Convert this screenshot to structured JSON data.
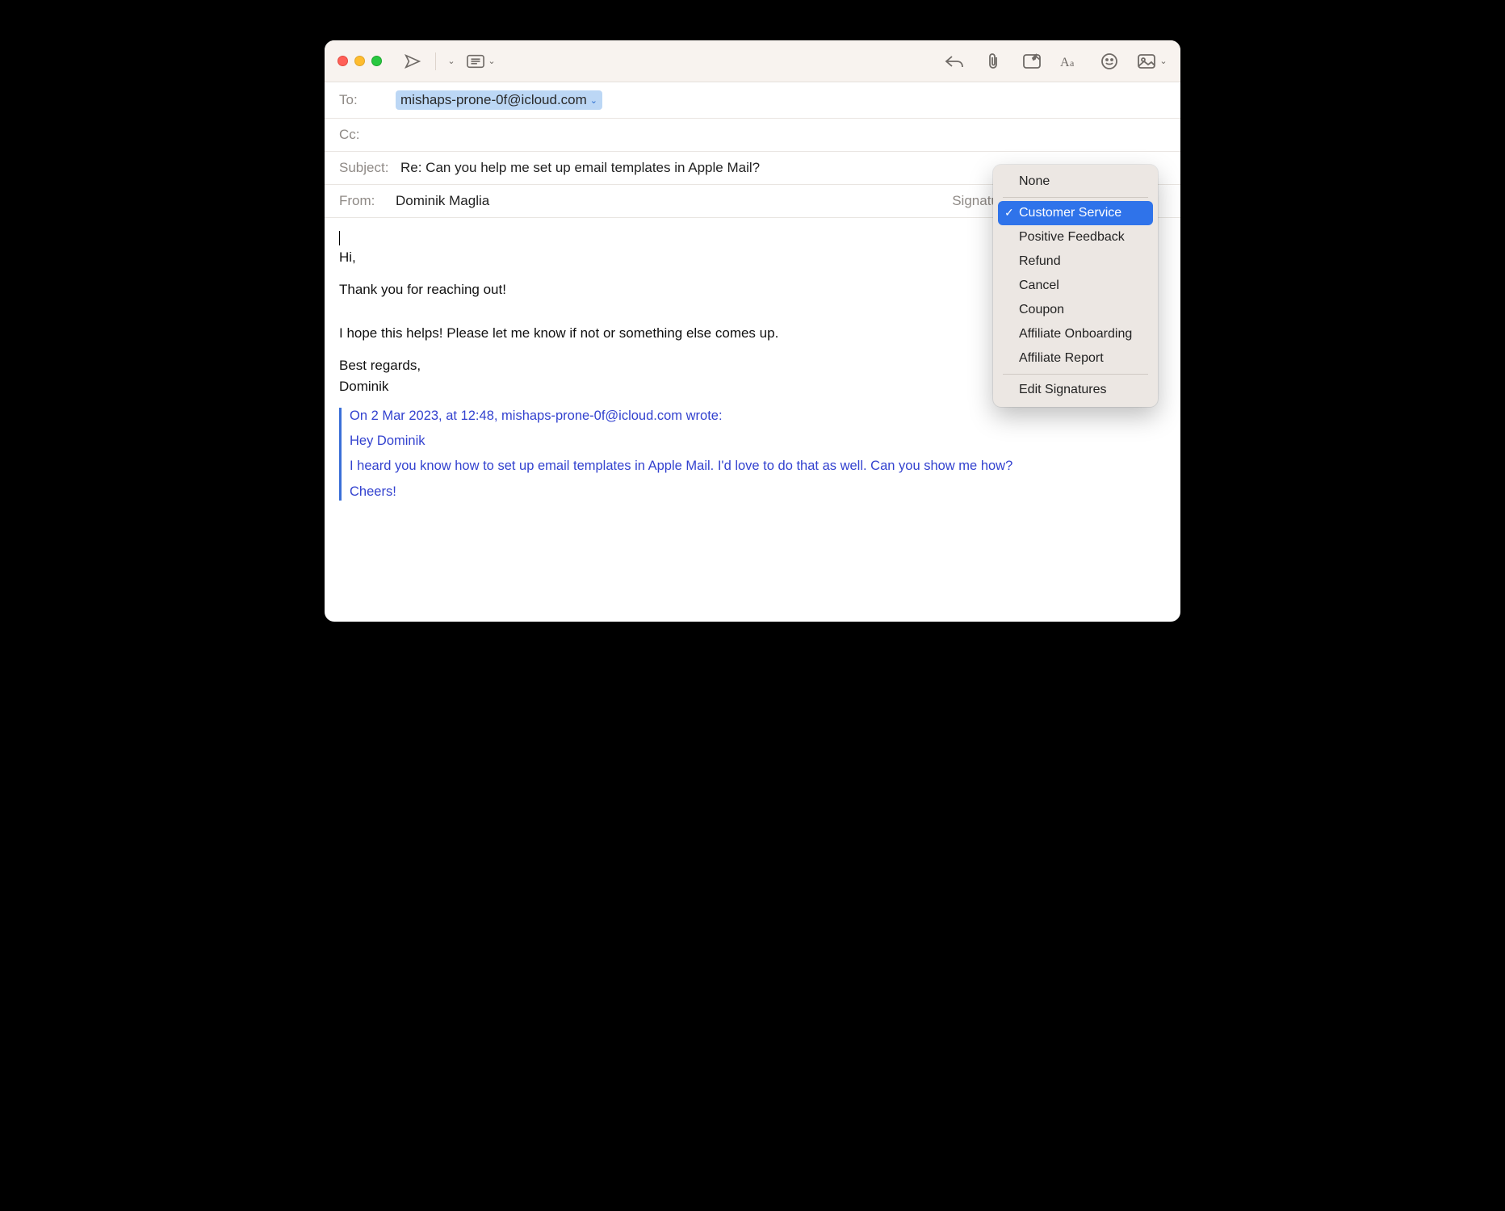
{
  "header": {
    "to_label": "To:",
    "to_value": "mishaps-prone-0f@icloud.com",
    "cc_label": "Cc:",
    "subject_label": "Subject:",
    "subject_value": "Re: Can you help me set up email templates in Apple Mail?",
    "from_label": "From:",
    "from_value": "Dominik Maglia",
    "signature_label": "Signature"
  },
  "body": {
    "greeting": "Hi,",
    "thanks": "Thank you for reaching out!",
    "hope": "I hope this helps! Please let me know if not or something else comes up.",
    "regards": "Best regards,",
    "name": "Dominik"
  },
  "quote": {
    "meta": "On 2 Mar 2023, at 12:48, mishaps-prone-0f@icloud.com wrote:",
    "line1": "Hey Dominik",
    "line2": "I heard you know how to set up email templates in Apple Mail. I'd love to do that as well. Can you show me how?",
    "line3": "Cheers!"
  },
  "signature_menu": {
    "none": "None",
    "items": [
      "Customer Service",
      "Positive Feedback",
      "Refund",
      "Cancel",
      "Coupon",
      "Affiliate Onboarding",
      "Affiliate Report"
    ],
    "selected_index": 0,
    "edit": "Edit Signatures"
  }
}
